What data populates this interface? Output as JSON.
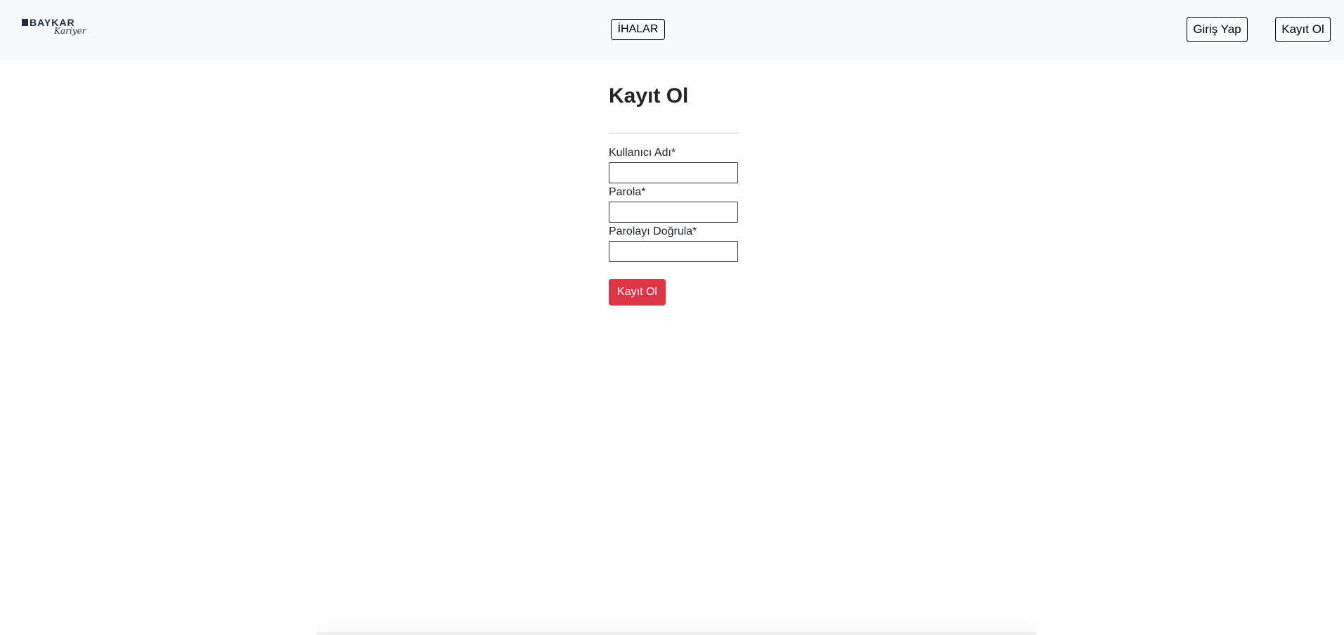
{
  "header": {
    "logo": {
      "brand": "BAYKAR",
      "script": "Kariyer"
    },
    "nav": {
      "ihalar_label": "İHALAR",
      "login_label": "Giriş Yap",
      "register_label": "Kayıt Ol"
    }
  },
  "form": {
    "title": "Kayıt Ol",
    "fields": [
      {
        "label": "Kullanıcı Adı*",
        "value": ""
      },
      {
        "label": "Parola*",
        "value": ""
      },
      {
        "label": "Parolayı Doğrula*",
        "value": ""
      }
    ],
    "submit_label": "Kayıt Ol"
  },
  "colors": {
    "header_bg": "#f8f9fa",
    "brand_navy": "#1f2a44",
    "submit_red": "#dc3545"
  }
}
